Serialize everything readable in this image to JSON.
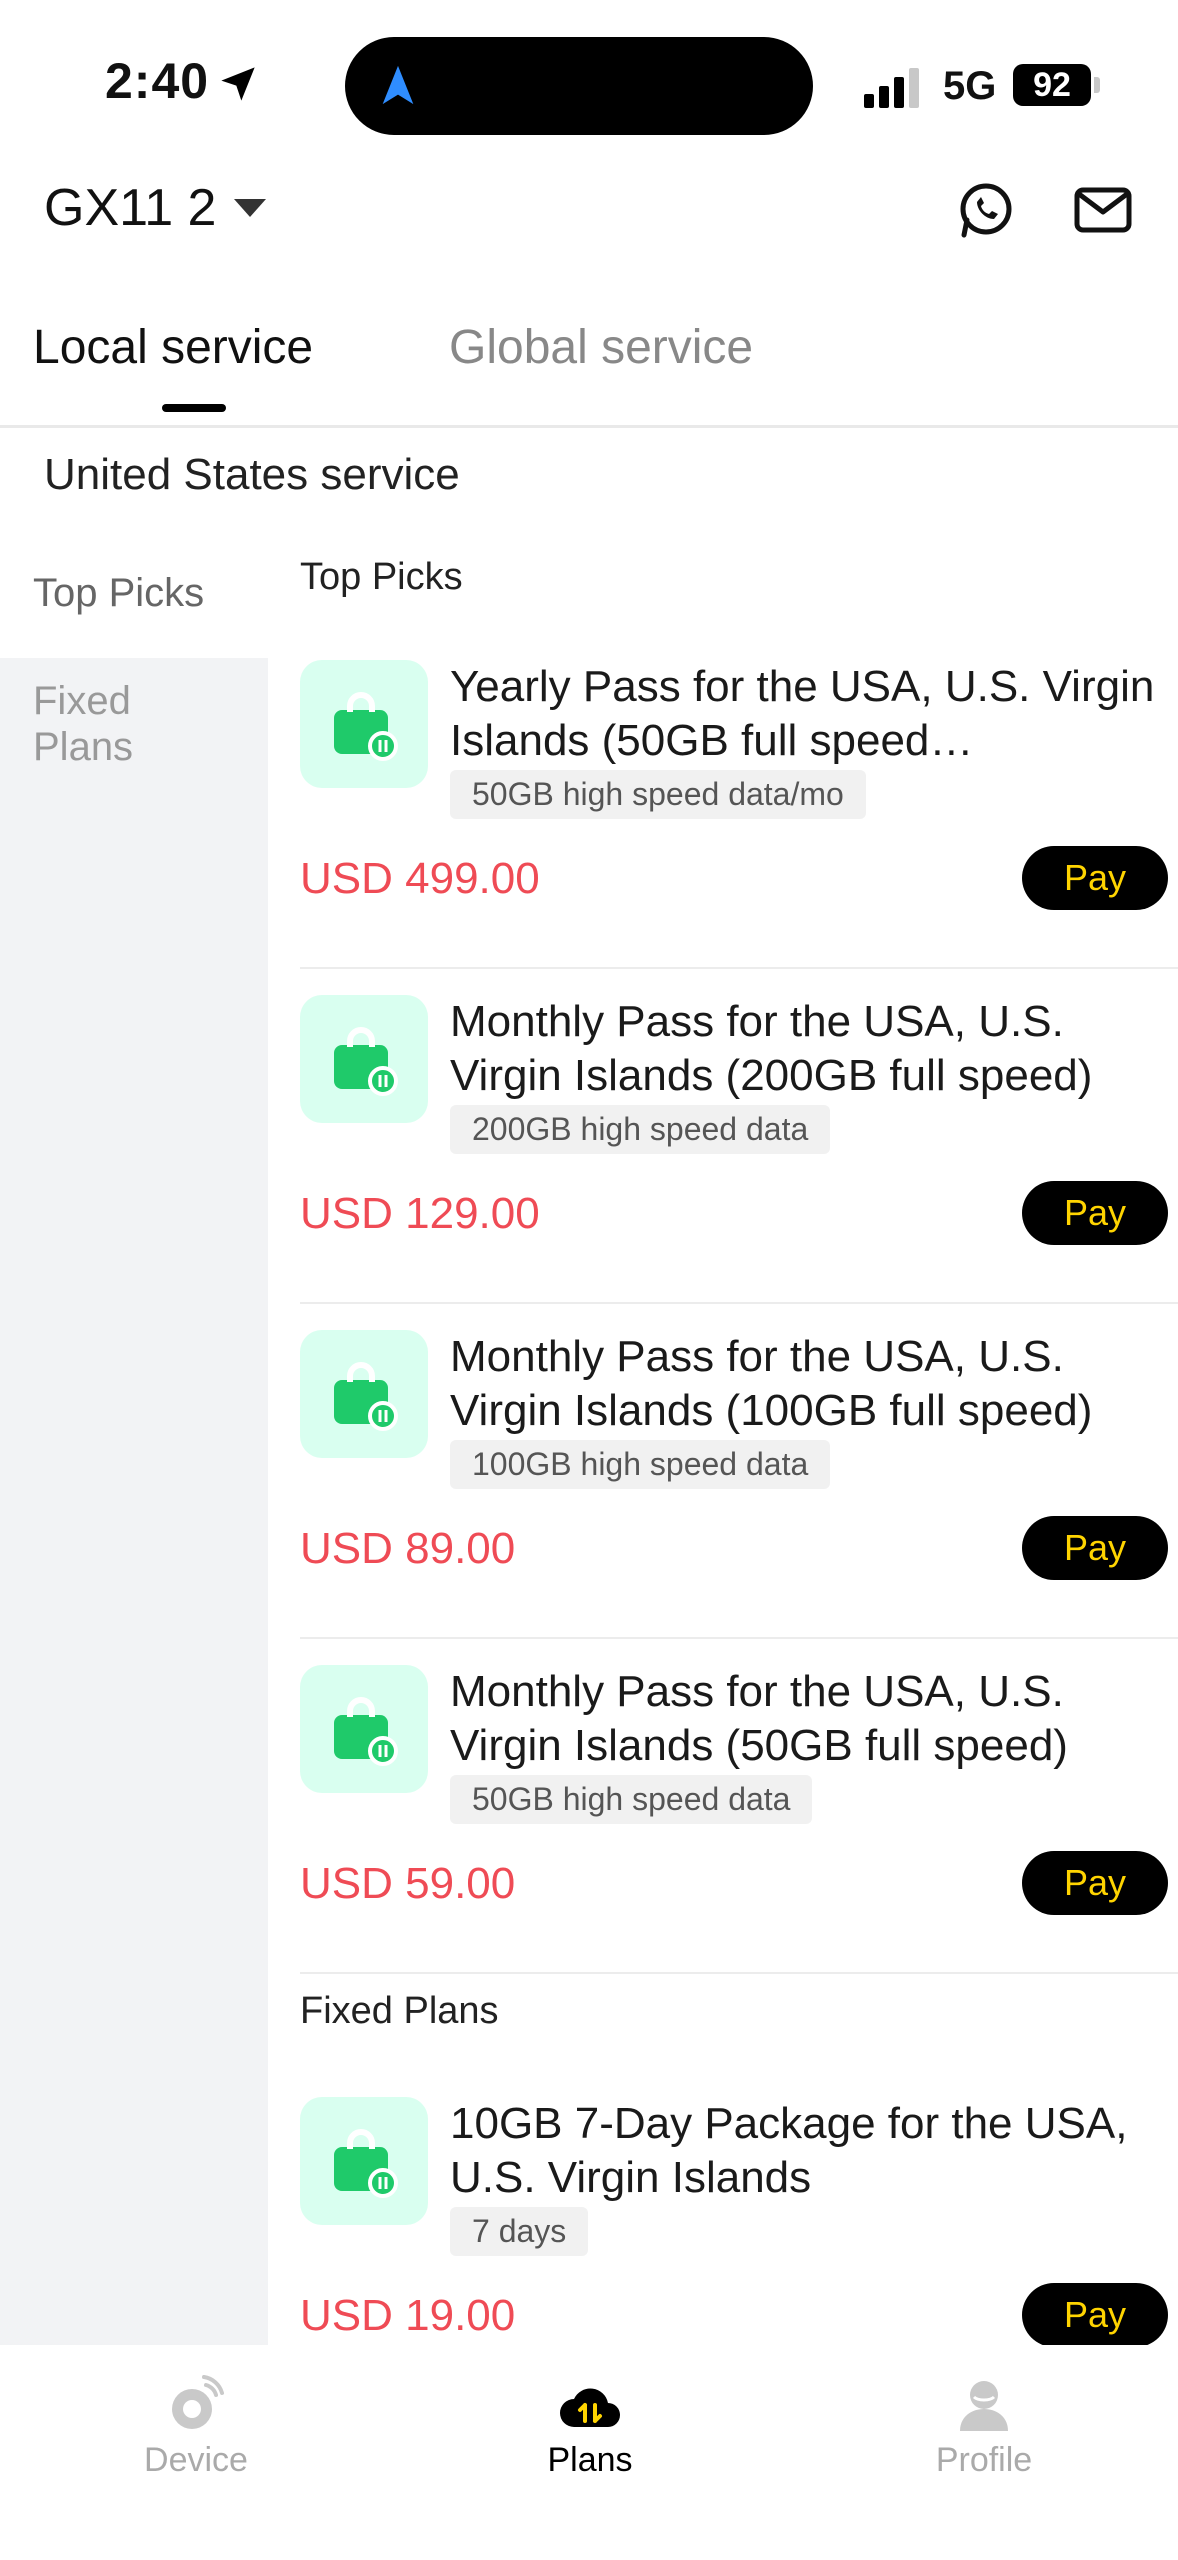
{
  "status_bar": {
    "time": "2:40",
    "network": "5G",
    "battery": "92"
  },
  "header": {
    "device_name": "GX11 2"
  },
  "tabs": [
    {
      "label": "Local service"
    },
    {
      "label": "Global service"
    }
  ],
  "region_title": "United States service",
  "sidebar": {
    "items": [
      {
        "label": "Top Picks"
      },
      {
        "label": "Fixed Plans"
      }
    ]
  },
  "sections": {
    "top_picks": {
      "title": "Top Picks",
      "cards": [
        {
          "title": "Yearly Pass for the USA, U.S. Virgin Islands (50GB full speed…",
          "chip": "50GB high speed data/mo",
          "price": "USD 499.00",
          "pay": "Pay"
        },
        {
          "title": "Monthly Pass for the USA, U.S. Virgin Islands (200GB full speed)",
          "chip": "200GB high speed data",
          "price": "USD 129.00",
          "pay": "Pay"
        },
        {
          "title": "Monthly Pass for the USA, U.S. Virgin Islands (100GB full speed)",
          "chip": "100GB high speed data",
          "price": "USD 89.00",
          "pay": "Pay"
        },
        {
          "title": "Monthly Pass for the USA, U.S. Virgin Islands (50GB full speed)",
          "chip": "50GB high speed data",
          "price": "USD 59.00",
          "pay": "Pay"
        }
      ]
    },
    "fixed_plans": {
      "title": "Fixed Plans",
      "cards": [
        {
          "title": "10GB 7-Day Package for the USA, U.S. Virgin Islands",
          "chip": "7 days",
          "price": "USD 19.00",
          "pay": "Pay"
        }
      ]
    }
  },
  "bottom_nav": [
    {
      "label": "Device"
    },
    {
      "label": "Plans"
    },
    {
      "label": "Profile"
    }
  ],
  "icons": {
    "location": "location-arrow-icon",
    "island": "navigation-arrow-icon",
    "whatsapp": "whatsapp-icon",
    "mail": "mail-icon",
    "plan": "shopping-bag-data-icon",
    "device": "device-icon",
    "plans": "cloud-data-icon",
    "profile": "profile-icon"
  },
  "colors": {
    "price": "#ef4b55",
    "pay_text": "#ffd400",
    "pay_bg": "#000000",
    "plan_icon_bg": "#d9fff0",
    "plan_icon": "#1fca6a"
  }
}
